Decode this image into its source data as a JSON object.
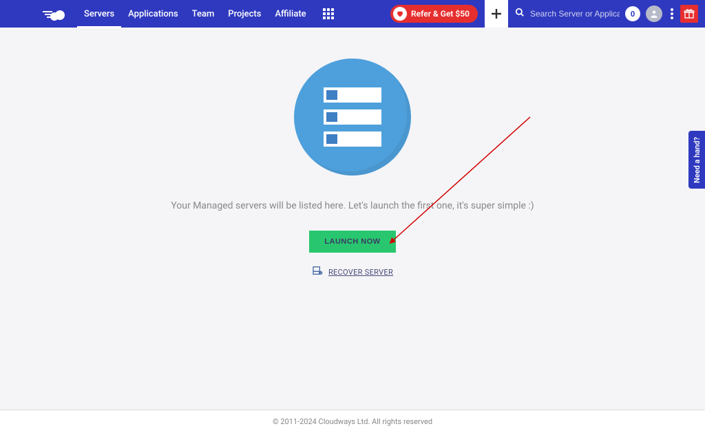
{
  "nav": {
    "items": [
      {
        "label": "Servers",
        "active": true
      },
      {
        "label": "Applications",
        "active": false
      },
      {
        "label": "Team",
        "active": false
      },
      {
        "label": "Projects",
        "active": false
      },
      {
        "label": "Affiliate",
        "active": false
      }
    ]
  },
  "refer": {
    "label": "Refer & Get $50"
  },
  "search": {
    "placeholder": "Search Server or Application"
  },
  "badge": {
    "count": "0"
  },
  "hero": {
    "message": "Your Managed servers will be listed here. Let's launch the first one, it's super simple :)",
    "launch_label": "LAUNCH NOW",
    "recover_label": "RECOVER SERVER"
  },
  "help_tab": {
    "label": "Need a hand?"
  },
  "footer": {
    "text": "© 2011-2024 Cloudways Ltd. All rights reserved"
  }
}
